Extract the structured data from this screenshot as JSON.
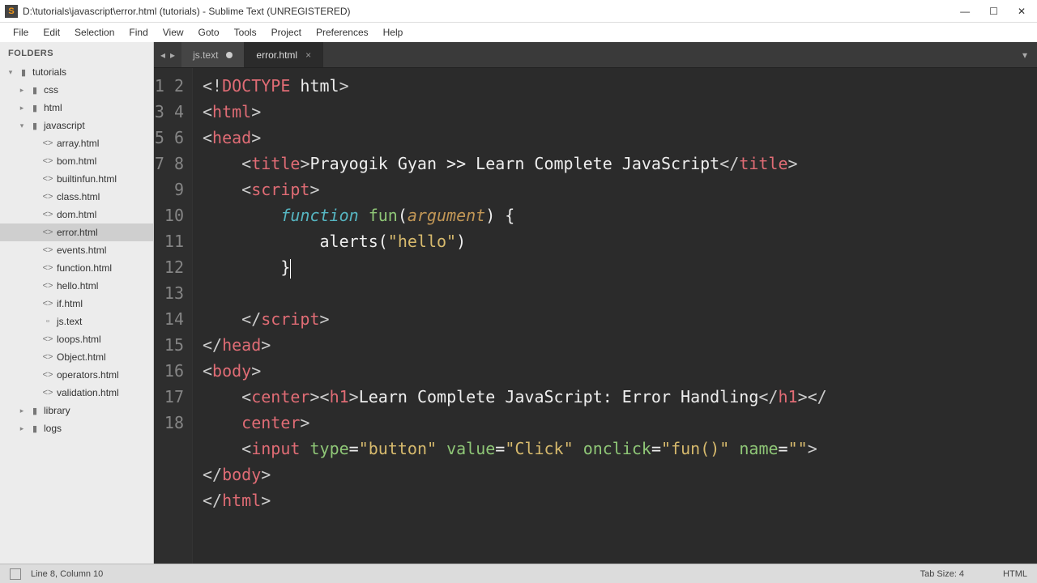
{
  "window": {
    "title": "D:\\tutorials\\javascript\\error.html (tutorials) - Sublime Text (UNREGISTERED)"
  },
  "menu": [
    "File",
    "Edit",
    "Selection",
    "Find",
    "View",
    "Goto",
    "Tools",
    "Project",
    "Preferences",
    "Help"
  ],
  "sidebar": {
    "header": "FOLDERS",
    "tree": [
      {
        "label": "tutorials",
        "type": "folder",
        "open": true,
        "depth": 0
      },
      {
        "label": "css",
        "type": "folder",
        "open": false,
        "depth": 1
      },
      {
        "label": "html",
        "type": "folder",
        "open": false,
        "depth": 1
      },
      {
        "label": "javascript",
        "type": "folder",
        "open": true,
        "depth": 1
      },
      {
        "label": "array.html",
        "type": "code",
        "depth": 2
      },
      {
        "label": "bom.html",
        "type": "code",
        "depth": 2
      },
      {
        "label": "builtinfun.html",
        "type": "code",
        "depth": 2
      },
      {
        "label": "class.html",
        "type": "code",
        "depth": 2
      },
      {
        "label": "dom.html",
        "type": "code",
        "depth": 2
      },
      {
        "label": "error.html",
        "type": "code",
        "depth": 2,
        "active": true
      },
      {
        "label": "events.html",
        "type": "code",
        "depth": 2
      },
      {
        "label": "function.html",
        "type": "code",
        "depth": 2
      },
      {
        "label": "hello.html",
        "type": "code",
        "depth": 2
      },
      {
        "label": "if.html",
        "type": "code",
        "depth": 2
      },
      {
        "label": "js.text",
        "type": "file",
        "depth": 2
      },
      {
        "label": "loops.html",
        "type": "code",
        "depth": 2
      },
      {
        "label": "Object.html",
        "type": "code",
        "depth": 2
      },
      {
        "label": "operators.html",
        "type": "code",
        "depth": 2
      },
      {
        "label": "validation.html",
        "type": "code",
        "depth": 2
      },
      {
        "label": "library",
        "type": "folder",
        "open": false,
        "depth": 1
      },
      {
        "label": "logs",
        "type": "folder",
        "open": false,
        "depth": 1
      }
    ]
  },
  "tabs": [
    {
      "label": "js.text",
      "dirty": true,
      "active": false
    },
    {
      "label": "error.html",
      "dirty": false,
      "active": true
    }
  ],
  "code": {
    "title_text": "Prayogik Gyan >> Learn Complete JavaScript",
    "function_name": "fun",
    "argument_name": "argument",
    "call_name": "alerts",
    "call_arg": "\"hello\"",
    "h1_text": "Learn Complete JavaScript: Error Handling",
    "input_type": "\"button\"",
    "input_value": "\"Click\"",
    "input_onclick": "\"fun()\"",
    "input_name": "\"\"",
    "line_count": 18
  },
  "status": {
    "position": "Line 8, Column 10",
    "tabsize": "Tab Size: 4",
    "syntax": "HTML"
  }
}
